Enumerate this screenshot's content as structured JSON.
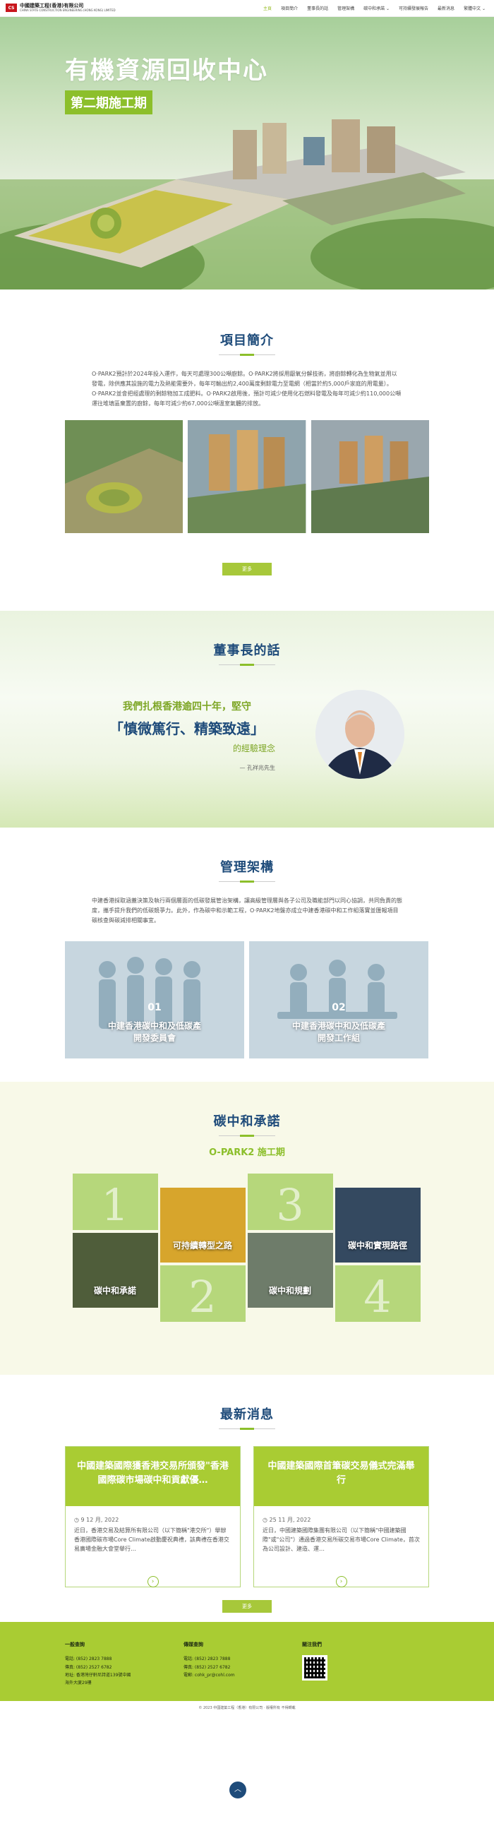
{
  "header": {
    "logo_cn": "中國建築工程(香港)有限公司",
    "logo_en": "CHINA STATE CONSTRUCTION ENGINEERING (HONG KONG) LIMITED",
    "nav": [
      {
        "label": "主頁",
        "active": true
      },
      {
        "label": "項目簡介",
        "active": false
      },
      {
        "label": "董事長的話",
        "active": false
      },
      {
        "label": "管理架構",
        "active": false
      },
      {
        "label": "碳中和承諾 ⌄",
        "active": false
      },
      {
        "label": "可持續發展報告",
        "active": false
      },
      {
        "label": "最新消息",
        "active": false
      },
      {
        "label": "繁體中文 ⌄",
        "active": false
      }
    ]
  },
  "hero": {
    "title": "有機資源回收中心",
    "badge": "第二期施工期"
  },
  "intro": {
    "title": "項目簡介",
    "text": "O·PARK2預計於2024年投入運作，每天可處理300公噸廚餘。O·PARK2將採用厭氧分解技術，將廚餘轉化為生物氣並用以發電，除供應其設施的電力及熱能需要外，每年可輸出約2,400萬度剩餘電力至電網（相當於約5,000戶家庭的用電量）。O·PARK2並會把經處理的剩餘物加工成肥料。O·PARK2啟用後，預計可減少使用化石燃料發電及每年可減少約110,000公噸運往堆填區棄置的廚餘，每年可減少約67,000公噸溫室氣體的排放。",
    "more": "更多"
  },
  "chairman": {
    "title": "董事長的話",
    "line1": "我們扎根香港逾四十年，堅守",
    "line2": "「慎微篤行、精築致遠」",
    "line3": "的經驗理念",
    "signature": "— 孔祥兆先生"
  },
  "management": {
    "title": "管理架構",
    "text": "中建香港採取涵蓋決策及執行兩個層面的低碳發展管治架構，讓高級管理層與各子公司及職能部門以同心協調，共同負責的態度，攜手提升我們的低碳競爭力。此外，作為碳中和示範工程，O·PARK2地盤亦成立中建香港碳中和工作組落實並匯報項目碳核查與碳減排相關事宜。",
    "cards": [
      {
        "num": "01",
        "label": "中建香港碳中和及低碳產\n開發委員會"
      },
      {
        "num": "02",
        "label": "中建香港碳中和及低碳產\n開發工作組"
      }
    ]
  },
  "carbon": {
    "title": "碳中和承諾",
    "subtitle": "O-PARK2 施工期",
    "items": [
      {
        "num": "1",
        "label": "碳中和承諾"
      },
      {
        "num": "2",
        "label": "可持續轉型之路"
      },
      {
        "num": "3",
        "label": "碳中和規劃"
      },
      {
        "num": "4",
        "label": "碳中和實現路徑"
      }
    ]
  },
  "news": {
    "title": "最新消息",
    "items": [
      {
        "headline": "中國建築國際獲香港交易所頒發\"香港國際碳市場碳中和貢獻優…",
        "date": "◷ 9 12 月, 2022",
        "excerpt": "近日，香港交易及結算所有限公司（以下簡稱\"港交所\"）舉辦香港國際碳市場Core Climate啟動慶祝典禮，該典禮在香港交易廣場金融大會堂舉行…"
      },
      {
        "headline": "中國建築國際首筆碳交易儀式完滿舉行",
        "date": "◷ 25 11 月, 2022",
        "excerpt": "近日，中國建築國際集團有限公司（以下簡稱\"中國建築國際\"或\"公司\"）通過香港交易所碳交易市場Core Climate，首次為公司設計、建造、運…"
      }
    ],
    "more": "更多"
  },
  "footer": {
    "col1_title": "一般查詢",
    "col1_lines": [
      "電話: (852) 2823 7888",
      "傳真: (852) 2527 6782",
      "地址: 香港灣仔軒尼詩道139號中國",
      "海外大廈29樓"
    ],
    "col2_title": "傳媒查詢",
    "col2_lines": [
      "電話: (852) 2823 7888",
      "傳真: (852) 2527 6782",
      "電郵: cohk_pr@cohl.com"
    ],
    "col3_title": "關注我們",
    "copyright": "© 2023 中國建築工程（香港）有限公司 · 版權所有 不得轉載"
  },
  "totop": "︿"
}
